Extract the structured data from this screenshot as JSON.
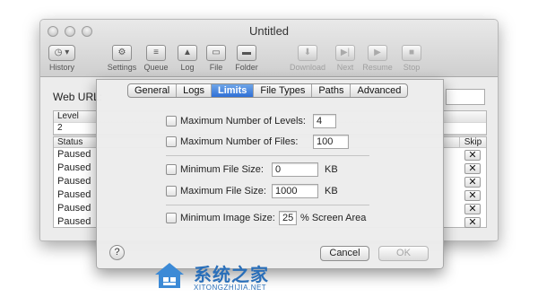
{
  "window": {
    "title": "Untitled"
  },
  "toolbar": [
    {
      "label": "History"
    },
    {
      "label": "Settings"
    },
    {
      "label": "Queue"
    },
    {
      "label": "Log"
    },
    {
      "label": "File"
    },
    {
      "label": "Folder"
    },
    {
      "label": "Download"
    },
    {
      "label": "Next"
    },
    {
      "label": "Resume"
    },
    {
      "label": "Stop"
    }
  ],
  "main": {
    "web_url_label": "Web URL:",
    "level_header": "Level",
    "level_value": "2",
    "status_header": "Status",
    "skip_header": "Skip",
    "skip_glyph": "✕",
    "rows": [
      "Paused",
      "Paused",
      "Paused",
      "Paused",
      "Paused",
      "Paused"
    ]
  },
  "sheet": {
    "tabs": [
      "General",
      "Logs",
      "Limits",
      "File Types",
      "Paths",
      "Advanced"
    ],
    "active_tab": "Limits",
    "options": {
      "max_levels": {
        "label": "Maximum Number of Levels:",
        "value": "4"
      },
      "max_files": {
        "label": "Maximum Number of Files:",
        "value": "100"
      },
      "min_file_size": {
        "label": "Minimum File Size:",
        "value": "0",
        "unit": "KB"
      },
      "max_file_size": {
        "label": "Maximum File Size:",
        "value": "1000",
        "unit": "KB"
      },
      "min_image_size": {
        "label": "Minimum Image Size:",
        "value": "25",
        "unit": "% Screen Area"
      }
    },
    "help_label": "?",
    "cancel_label": "Cancel",
    "ok_label": "OK"
  },
  "watermark": {
    "text": "系统之家",
    "url": "XITONGZHIJIA.NET"
  },
  "colors": {
    "accent": "#3a78dc",
    "watermark": "#2a6fb9"
  }
}
